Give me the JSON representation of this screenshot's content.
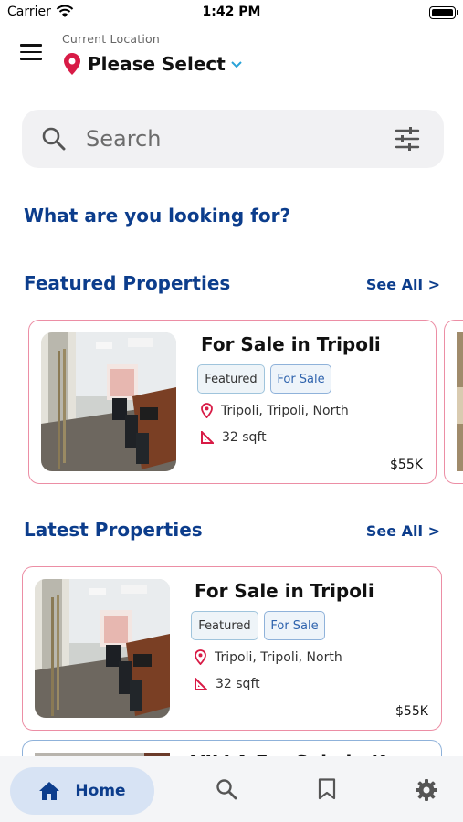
{
  "status_bar": {
    "carrier": "Carrier",
    "time": "1:42 PM"
  },
  "header": {
    "location_label": "Current Location",
    "location_value": "Please Select"
  },
  "search": {
    "placeholder": "Search"
  },
  "looking_for": "What are you looking for?",
  "featured": {
    "title": "Featured Properties",
    "see_all": "See All >",
    "cards": [
      {
        "title": "For Sale in Tripoli",
        "tags": [
          "Featured",
          "For Sale"
        ],
        "location": "Tripoli, Tripoli, North",
        "area": "32 sqft",
        "price": "$55K"
      }
    ]
  },
  "latest": {
    "title": "Latest Properties",
    "see_all": "See All >",
    "cards": [
      {
        "title": "For Sale in Tripoli",
        "tags": [
          "Featured",
          "For Sale"
        ],
        "location": "Tripoli, Tripoli, North",
        "area": "32 sqft",
        "price": "$55K"
      },
      {
        "title": "VILLA For Sale in Koura"
      }
    ]
  },
  "bottom_nav": {
    "home_label": "Home",
    "items": [
      "home-icon",
      "search-icon",
      "bookmark-icon",
      "gear-icon"
    ]
  },
  "colors": {
    "accent": "#0c3d8c",
    "card_border": "#ec8ea5",
    "pin": "#d81b46",
    "nav_active_bg": "#d7e3f4"
  }
}
